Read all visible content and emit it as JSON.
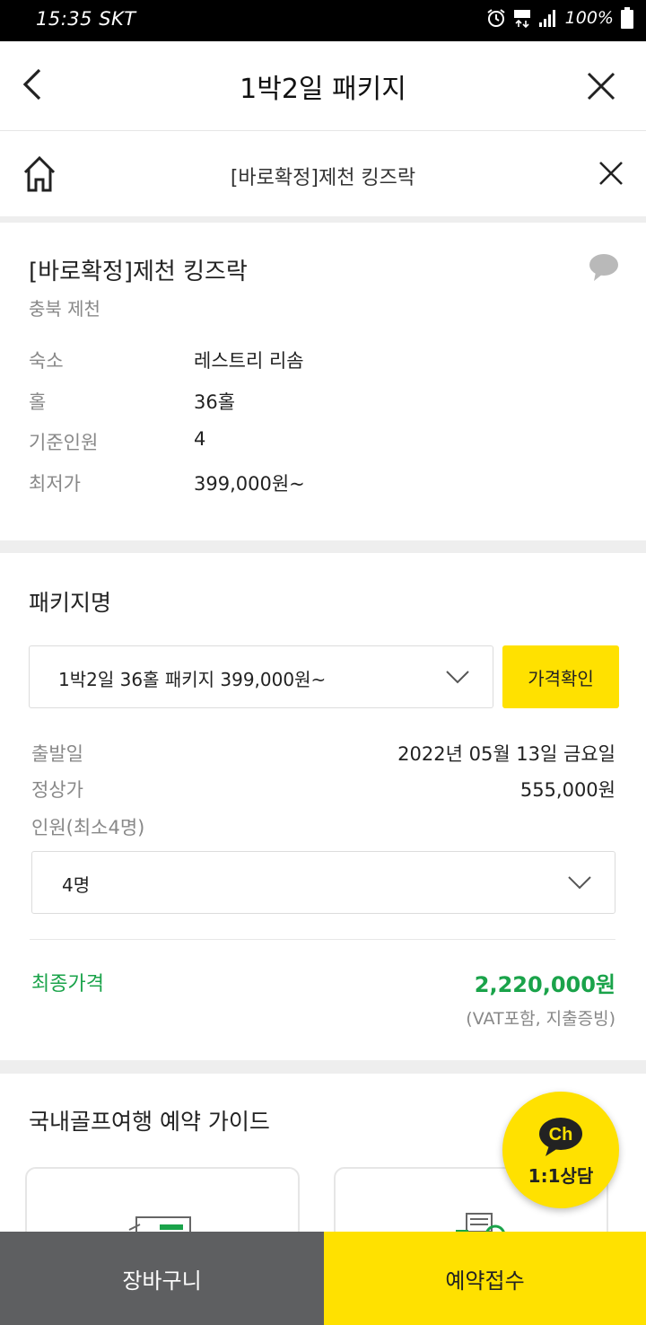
{
  "status_bar": {
    "time": "15:35 SKT",
    "battery": "100%"
  },
  "app_bar": {
    "title": "1박2일 패키지"
  },
  "sub_bar": {
    "title": "[바로확정]제천 킹즈락"
  },
  "course_info": {
    "name": "[바로확정]제천 킹즈락",
    "region": "충북 제천",
    "rows": [
      {
        "label": "숙소",
        "value": "레스트리 리솜"
      },
      {
        "label": "홀",
        "value": "36홀"
      },
      {
        "label": "기준인원",
        "value": "4"
      },
      {
        "label": "최저가",
        "value": "399,000원~"
      }
    ]
  },
  "package": {
    "heading": "패키지명",
    "selected": "1박2일 36홀 패키지 399,000원~",
    "price_check_label": "가격확인",
    "departure_label": "출발일",
    "departure_value": "2022년 05월 13일 금요일",
    "regular_price_label": "정상가",
    "regular_price_value": "555,000원",
    "people_label": "인원(최소4명)",
    "people_selected": "4명",
    "final_label": "최종가격",
    "final_price": "2,220,000원",
    "vat_note": "(VAT포함, 지출증빙)"
  },
  "guide": {
    "heading": "국내골프여행 예약 가이드"
  },
  "chat_button": {
    "badge": "Ch",
    "label": "1:1상담"
  },
  "bottom_bar": {
    "cart_label": "장바구니",
    "reserve_label": "예약접수"
  },
  "colors": {
    "accent_yellow": "#ffe100",
    "final_green": "#1aa34a",
    "cart_gray": "#5e5f61"
  }
}
